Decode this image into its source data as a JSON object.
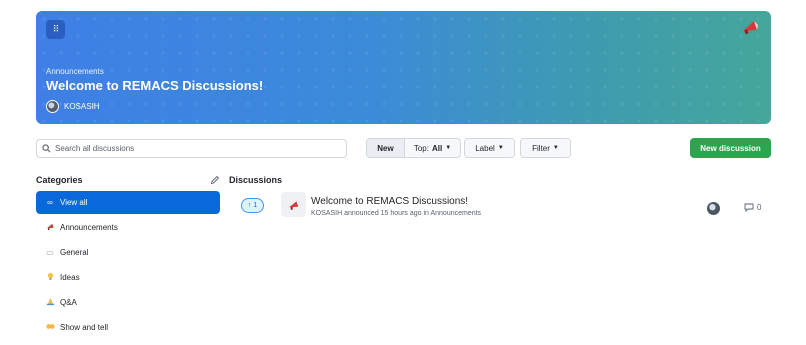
{
  "banner": {
    "category": "Announcements",
    "title": "Welcome to REMACS Discussions!",
    "author": "KOSASIH",
    "grip_icon": "grip-icon",
    "category_icon": "megaphone-icon",
    "gradient_start": "#3f7fe6",
    "gradient_end": "#45a69a"
  },
  "toolbar": {
    "search_placeholder": "Search all discussions",
    "new_label": "New",
    "top_label": "Top:",
    "top_value": "All",
    "label_label": "Label",
    "filter_label": "Filter",
    "new_discussion_label": "New discussion"
  },
  "categories": {
    "title": "Categories",
    "items": [
      {
        "label": "View all",
        "icon": "infinity-icon",
        "active": true
      },
      {
        "label": "Announcements",
        "icon": "megaphone-icon",
        "active": false
      },
      {
        "label": "General",
        "icon": "speech-icon",
        "active": false
      },
      {
        "label": "Ideas",
        "icon": "lightbulb-icon",
        "active": false
      },
      {
        "label": "Q&A",
        "icon": "pray-icon",
        "active": false
      },
      {
        "label": "Show and tell",
        "icon": "raised-hands-icon",
        "active": false
      }
    ]
  },
  "discussions": {
    "title": "Discussions",
    "items": [
      {
        "votes": "1",
        "title": "Welcome to REMACS Discussions!",
        "meta": "KOSASIH announced 15 hours ago in Announcements",
        "comments": "0"
      }
    ]
  },
  "colors": {
    "accent": "#0969da",
    "primary_button": "#2da44e"
  }
}
